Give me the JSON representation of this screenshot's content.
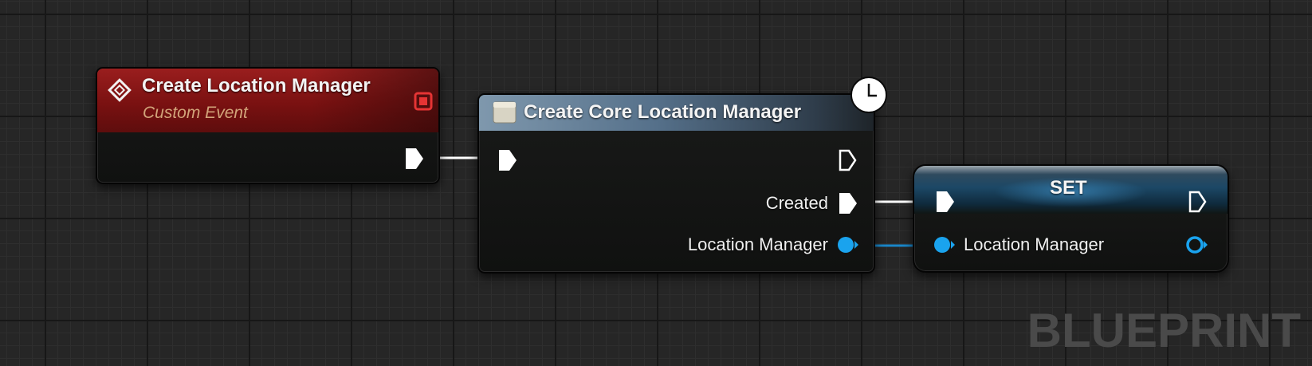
{
  "nodes": {
    "event": {
      "title": "Create Location Manager",
      "subtitle": "Custom Event",
      "header_color": "#8b1414",
      "icon": "event-diamond-icon"
    },
    "function": {
      "title": "Create Core Location Manager",
      "header_color": "#6b879e",
      "icon": "function-box-icon",
      "badge_icon": "latent-clock-icon",
      "outputs": {
        "created_label": "Created",
        "location_manager_label": "Location Manager"
      }
    },
    "set": {
      "title": "SET",
      "input_label": "Location Manager"
    }
  },
  "colors": {
    "exec_pin": "#ffffff",
    "object_pin": "#1aa3ee",
    "wire_object": "#1a86c8",
    "wire_exec": "#ffffff"
  },
  "watermark": "BLUEPRINT"
}
